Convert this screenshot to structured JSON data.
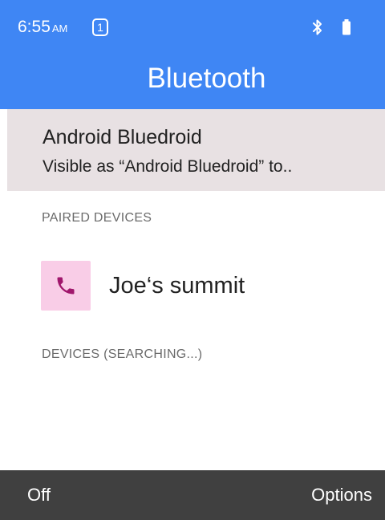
{
  "status_bar": {
    "time": "6:55",
    "ampm": "AM",
    "notification_count": "1",
    "icons": [
      "bluetooth-icon",
      "battery-icon"
    ]
  },
  "header": {
    "title": "Bluetooth"
  },
  "device": {
    "name": "Android Bluedroid",
    "visibility": "Visible as “Android Bluedroid” to.."
  },
  "paired_section": {
    "header": "PAIRED DEVICES",
    "devices": [
      {
        "name": "Joe‘s summit",
        "icon": "phone-icon"
      }
    ]
  },
  "available_section": {
    "header": "DEVICES (SEARCHING...)"
  },
  "softkeys": {
    "left": "Off",
    "right": "Options"
  },
  "colors": {
    "header_bg": "#3f86f4",
    "device_block_bg": "#e8e1e3",
    "device_icon_bg": "#f9cde7",
    "device_icon_fg": "#a0176c",
    "softkey_bg": "#404040"
  }
}
